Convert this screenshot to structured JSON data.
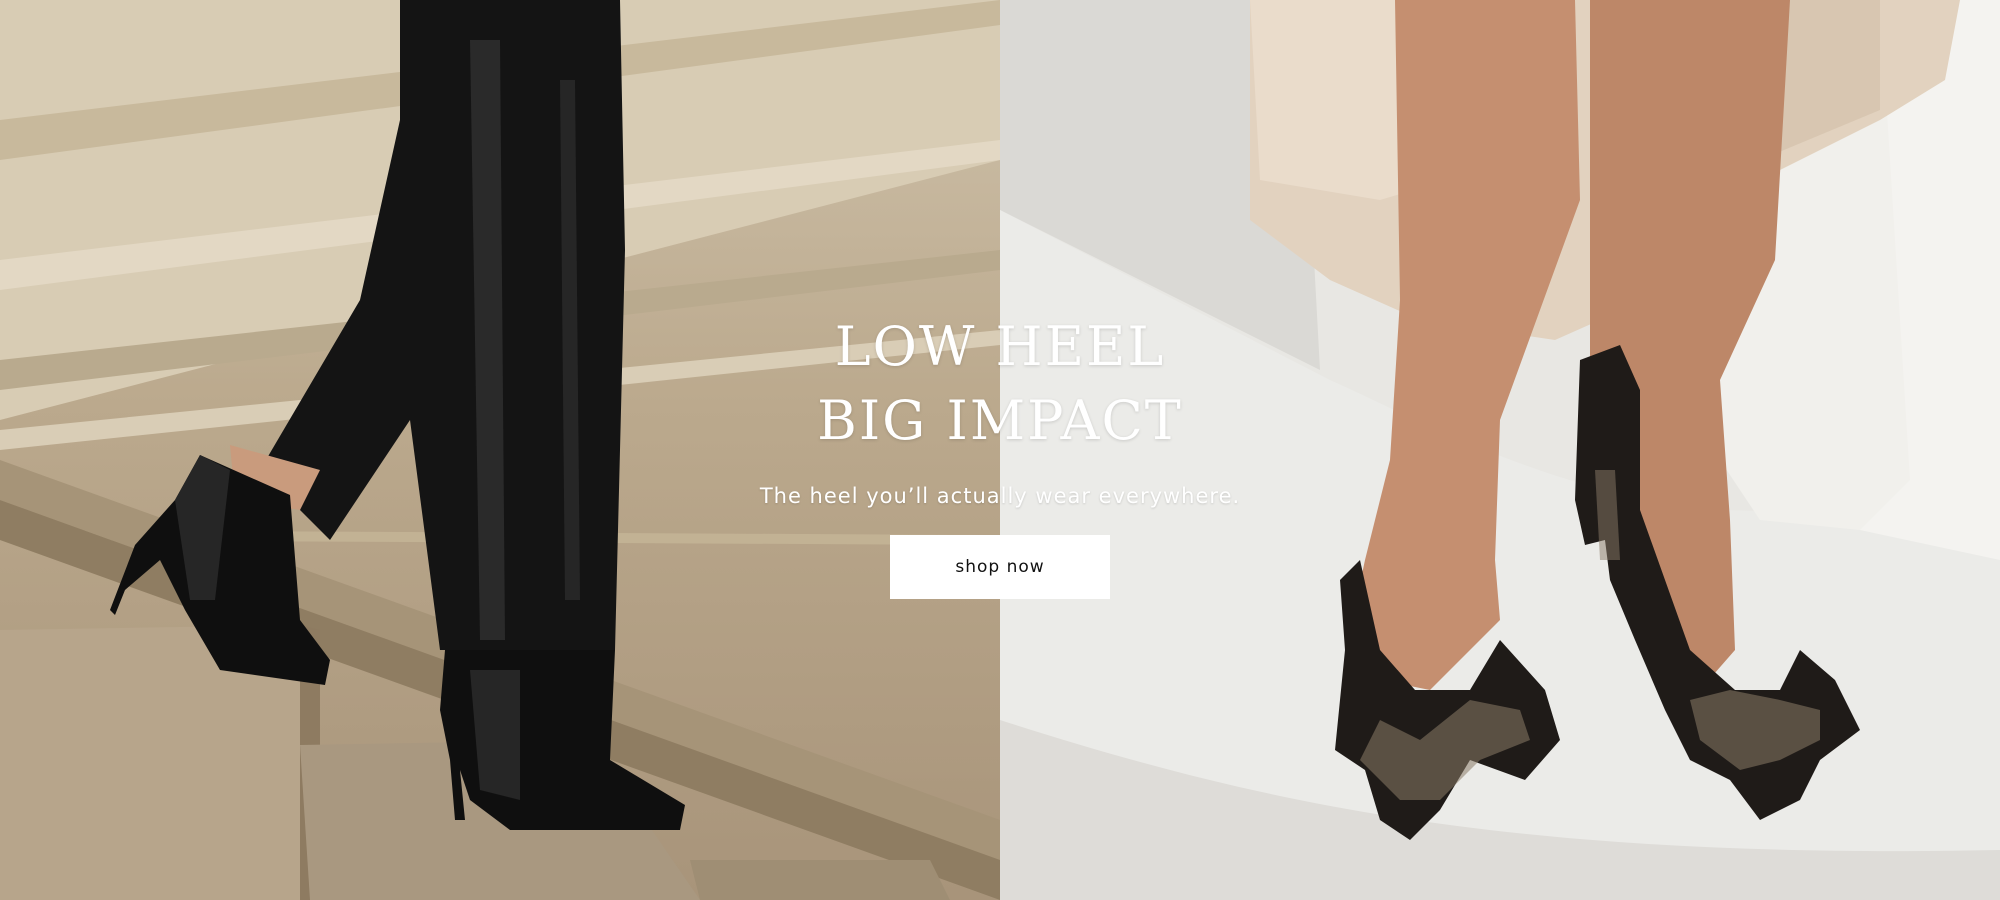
{
  "hero": {
    "headline_line1": "LOW HEEL",
    "headline_line2": "BIG IMPACT",
    "subheadline": "The heel you’ll actually wear everywhere.",
    "cta_label": "shop now"
  },
  "images": {
    "left": "black leather ankle boots on stone stairs",
    "right": "tweed bow slingback heels on white sofa"
  },
  "colors": {
    "text": "#ffffff",
    "button_bg": "#ffffff",
    "button_text": "#111111"
  }
}
